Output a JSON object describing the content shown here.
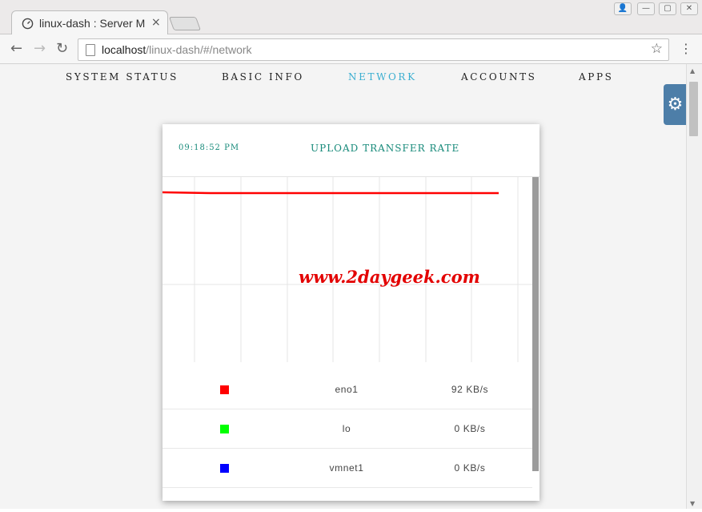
{
  "browser": {
    "tab_title": "linux-dash : Server M",
    "tab_close": "×",
    "url_host": "localhost",
    "url_path": "/linux-dash/#/network",
    "back": "←",
    "forward": "→",
    "reload": "↻",
    "star": "☆",
    "menu": "⋮",
    "window_buttons": [
      "👤",
      "—",
      "▢",
      "✕"
    ]
  },
  "nav": {
    "items": [
      {
        "label": "SYSTEM STATUS",
        "active": false
      },
      {
        "label": "BASIC INFO",
        "active": false
      },
      {
        "label": "NETWORK",
        "active": true
      },
      {
        "label": "ACCOUNTS",
        "active": false
      },
      {
        "label": "APPS",
        "active": false
      }
    ],
    "settings_icon": "gear-icon",
    "settings_glyph": "⚙"
  },
  "card": {
    "time": "09:18:52 PM",
    "title": "UPLOAD TRANSFER RATE",
    "watermark": "www.2daygeek.com"
  },
  "chart_data": {
    "type": "line",
    "series": [
      {
        "name": "eno1",
        "color": "#ff0000",
        "values": [
          92,
          92,
          92,
          92,
          92,
          92,
          92,
          92
        ]
      },
      {
        "name": "lo",
        "color": "#00ff00",
        "values": [
          0,
          0,
          0,
          0,
          0,
          0,
          0,
          0
        ]
      },
      {
        "name": "vmnet1",
        "color": "#0000ff",
        "values": [
          0,
          0,
          0,
          0,
          0,
          0,
          0,
          0
        ]
      }
    ],
    "grid": true
  },
  "interfaces": [
    {
      "name": "eno1",
      "rate": "92 KB/s",
      "color": "#ff0000"
    },
    {
      "name": "lo",
      "rate": "0 KB/s",
      "color": "#00ff00"
    },
    {
      "name": "vmnet1",
      "rate": "0 KB/s",
      "color": "#0000ff"
    }
  ],
  "colors": {
    "accent": "#3aaed0",
    "card_heading": "#178a7a",
    "settings_bg": "#4d7ea8"
  }
}
